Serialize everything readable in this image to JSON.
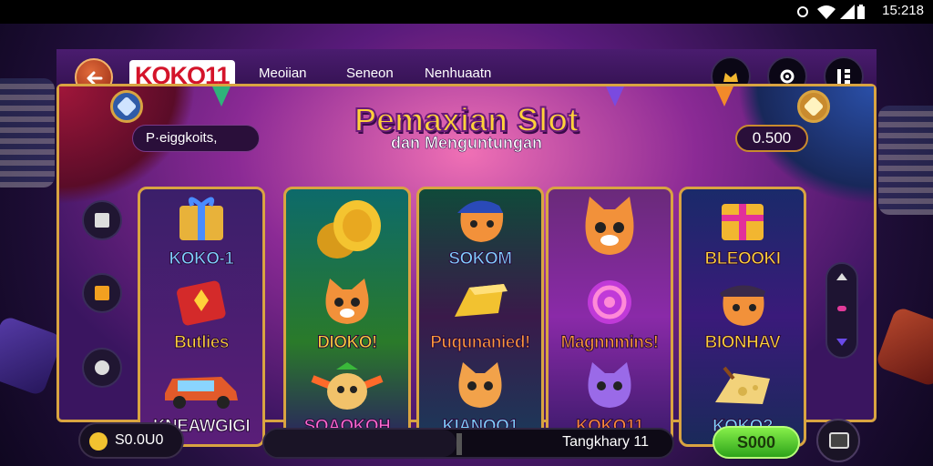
{
  "status_bar": {
    "time": "15:218",
    "icons": [
      "notification-icon",
      "wifi-icon",
      "signal-icon",
      "battery-icon"
    ]
  },
  "header": {
    "logo": "KOKO11",
    "nav": [
      "Meoiian",
      "Seneon",
      "Nenhuaatn"
    ],
    "right_buttons": [
      "crown-icon",
      "gear-icon",
      "grid-icon"
    ]
  },
  "title": {
    "main": "Pemaxian Slot",
    "sub": "dan Menguntungan"
  },
  "left_label": "P·eiggkoits,",
  "coin_display": "0.500",
  "reels": [
    {
      "captions": [
        "KOKO-1",
        "Butlies",
        "KNEAWGIGI"
      ],
      "caption_colors": [
        "#7fd2ff",
        "#ffd23a",
        "#ffffff"
      ]
    },
    {
      "captions": [
        "",
        "DIOKO!",
        "SOAOKOH"
      ],
      "caption_colors": [
        "#ffd23a",
        "#ffd23a",
        "#ff6ad0"
      ]
    },
    {
      "captions": [
        "SOKOM",
        "Puqunanied!",
        "KIANOO1"
      ],
      "caption_colors": [
        "#7fd2ff",
        "#ff9a3a",
        "#7fd2ff"
      ]
    },
    {
      "captions": [
        "",
        "Magnnmins!",
        "KOKO11"
      ],
      "caption_colors": [
        "#ffd23a",
        "#ff9a3a",
        "#ff8a3a"
      ]
    },
    {
      "captions": [
        "BLEOOKI",
        "BIONHAV",
        "KOKO?"
      ],
      "caption_colors": [
        "#ffd23a",
        "#ffd23a",
        "#7fd2ff"
      ]
    }
  ],
  "balance": "S0.0U0",
  "progress": {
    "text": "Tangkhary 11",
    "fraction": 0.47
  },
  "spin_label": "S000",
  "colors": {
    "accent_gold": "#d9a441",
    "spin_green": "#2da31a",
    "brand_red": "#d4142a"
  }
}
